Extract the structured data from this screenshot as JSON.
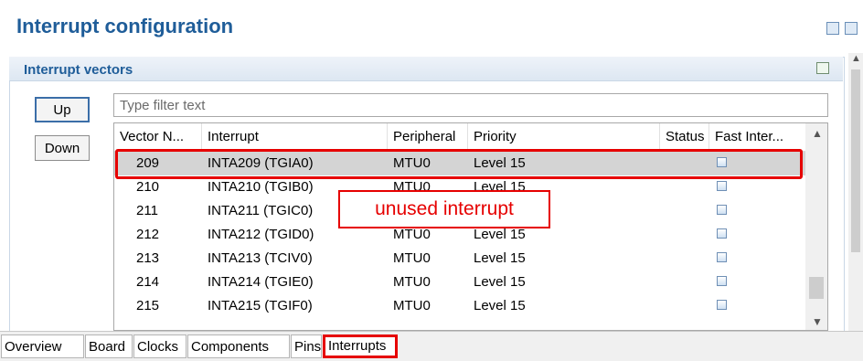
{
  "header": {
    "title": "Interrupt configuration"
  },
  "section": {
    "title": "Interrupt vectors"
  },
  "buttons": {
    "up": "Up",
    "down": "Down"
  },
  "filter": {
    "placeholder": "Type filter text",
    "value": ""
  },
  "table": {
    "columns": [
      "Vector N...",
      "Interrupt",
      "Peripheral",
      "Priority",
      "Status",
      "Fast Inter..."
    ],
    "rows": [
      {
        "vector": "209",
        "interrupt": "INTA209 (TGIA0)",
        "peripheral": "MTU0",
        "priority": "Level 15",
        "status": "",
        "fast": false,
        "selected": true
      },
      {
        "vector": "210",
        "interrupt": "INTA210 (TGIB0)",
        "peripheral": "MTU0",
        "priority": "Level 15",
        "status": "",
        "fast": false,
        "selected": false
      },
      {
        "vector": "211",
        "interrupt": "INTA211 (TGIC0)",
        "peripheral": "",
        "priority": "",
        "status": "",
        "fast": false,
        "selected": false
      },
      {
        "vector": "212",
        "interrupt": "INTA212 (TGID0)",
        "peripheral": "MTU0",
        "priority": "Level 15",
        "status": "",
        "fast": false,
        "selected": false
      },
      {
        "vector": "213",
        "interrupt": "INTA213 (TCIV0)",
        "peripheral": "MTU0",
        "priority": "Level 15",
        "status": "",
        "fast": false,
        "selected": false
      },
      {
        "vector": "214",
        "interrupt": "INTA214 (TGIE0)",
        "peripheral": "MTU0",
        "priority": "Level 15",
        "status": "",
        "fast": false,
        "selected": false
      },
      {
        "vector": "215",
        "interrupt": "INTA215 (TGIF0)",
        "peripheral": "MTU0",
        "priority": "Level 15",
        "status": "",
        "fast": false,
        "selected": false
      }
    ]
  },
  "annotation": {
    "callout": "unused interrupt"
  },
  "tabs": [
    "Overview",
    "Board",
    "Clocks",
    "Components",
    "Pins",
    "Interrupts"
  ],
  "active_tab": "Interrupts",
  "colors": {
    "title": "#1f5d99",
    "highlight": "#e60000",
    "selected_row": "#d4d4d4"
  }
}
